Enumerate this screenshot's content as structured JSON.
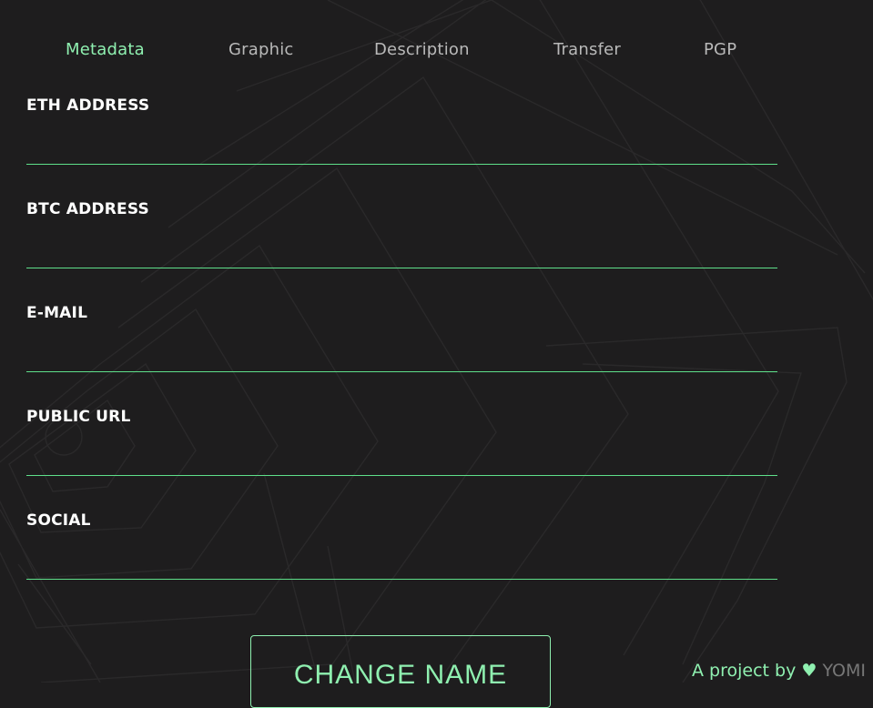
{
  "tabs": [
    {
      "label": "Metadata",
      "active": true
    },
    {
      "label": "Graphic",
      "active": false
    },
    {
      "label": "Description",
      "active": false
    },
    {
      "label": "Transfer",
      "active": false
    },
    {
      "label": "PGP",
      "active": false
    }
  ],
  "fields": [
    {
      "label": "ETH ADDRESS",
      "value": ""
    },
    {
      "label": "BTC ADDRESS",
      "value": ""
    },
    {
      "label": "E-MAIL",
      "value": ""
    },
    {
      "label": "PUBLIC URL",
      "value": ""
    },
    {
      "label": "SOCIAL",
      "value": ""
    }
  ],
  "submit_label": "CHANGE NAME",
  "footer": {
    "credit": "A project by",
    "heart": "♥",
    "brand": "YOMI"
  },
  "colors": {
    "background": "#1e1d1e",
    "accent": "#8ff0b0",
    "underline": "#5ee08a",
    "tab_inactive": "#b9b9b9",
    "brand_muted": "#777777"
  }
}
